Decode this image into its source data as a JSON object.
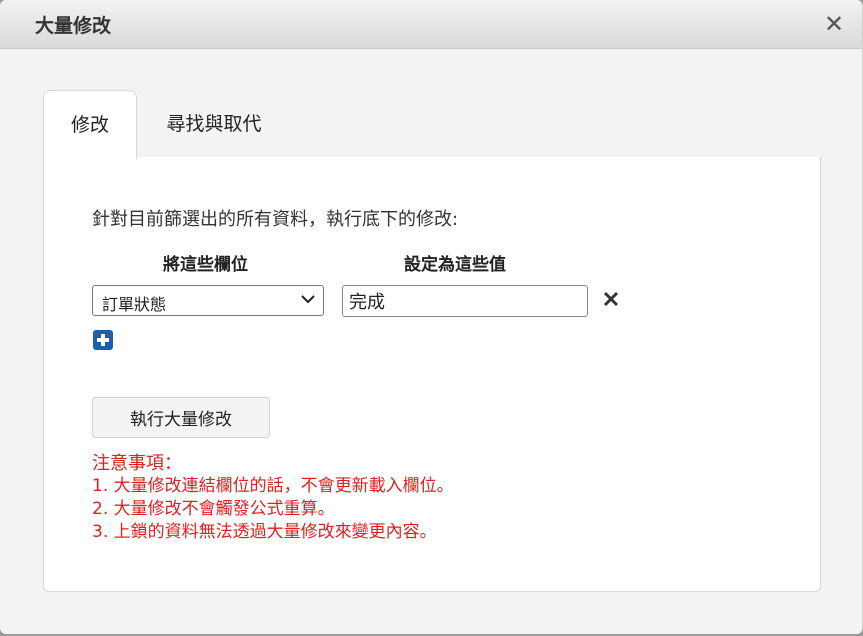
{
  "dialog": {
    "title": "大量修改",
    "close_glyph": "✕"
  },
  "tabs": [
    {
      "label": "修改",
      "active": true
    },
    {
      "label": "尋找與取代",
      "active": false
    }
  ],
  "form": {
    "instruction": "針對目前篩選出的所有資料，執行底下的修改:",
    "field_header": "將這些欄位",
    "value_header": "設定為這些值",
    "field_select_value": "訂單狀態",
    "value_input_value": "完成"
  },
  "actions": {
    "run_label": "執行大量修改"
  },
  "notes": {
    "heading": "注意事項：",
    "items": [
      "1. 大量修改連結欄位的話，不會更新載入欄位。",
      "2. 大量修改不會觸發公式重算。",
      "3. 上鎖的資料無法透過大量修改來變更內容。"
    ]
  },
  "colors": {
    "warning": "#e02020",
    "add_button": "#1f5fa8"
  },
  "icons": {
    "close": "close-icon",
    "dropdown": "chevron-down-icon",
    "remove": "remove-x-icon",
    "add": "plus-square-icon"
  }
}
